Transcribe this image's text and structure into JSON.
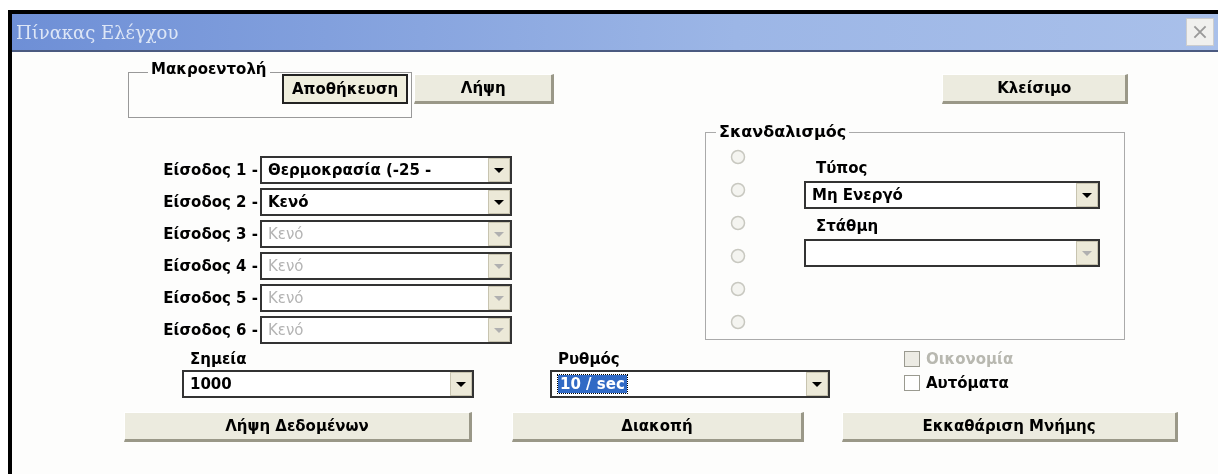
{
  "window": {
    "title": "Πίνακας Ελέγχου"
  },
  "macro": {
    "legend": "Μακροεντολή",
    "buttons": [
      "Αποθήκευση",
      "Λήψη"
    ]
  },
  "close_button": "Κλείσιμο",
  "inputs": [
    {
      "label": "Είσοδος 1 -",
      "value": "Θερμοκρασία (-25 -",
      "disabled": false
    },
    {
      "label": "Είσοδος 2 -",
      "value": "Κενό",
      "disabled": false
    },
    {
      "label": "Είσοδος 3 -",
      "value": "Κενό",
      "disabled": true
    },
    {
      "label": "Είσοδος 4 -",
      "value": "Κενό",
      "disabled": true
    },
    {
      "label": "Είσοδος 5 -",
      "value": "Κενό",
      "disabled": true
    },
    {
      "label": "Είσοδος 6 -",
      "value": "Κενό",
      "disabled": true
    }
  ],
  "scan": {
    "legend": "Σκανδαλισμός",
    "radios": [
      {
        "selected": false,
        "disabled": true
      },
      {
        "selected": false,
        "disabled": true
      },
      {
        "selected": false,
        "disabled": true
      },
      {
        "selected": false,
        "disabled": true
      },
      {
        "selected": false,
        "disabled": true
      },
      {
        "selected": false,
        "disabled": true
      }
    ],
    "type_label": "Τύπος",
    "type": {
      "value": "Μη Ενεργό",
      "disabled": false
    },
    "level_label": "Στάθμη",
    "level": {
      "disabled": true
    }
  },
  "points": {
    "label": "Σημεία",
    "value": "1000",
    "highlighted": false
  },
  "rate": {
    "label": "Ρυθμός",
    "value": "10 / sec",
    "highlighted": true
  },
  "checkboxes": [
    {
      "label": "Οικονομία",
      "checked": false,
      "disabled": true
    },
    {
      "label": "Αυτόματα",
      "checked": false,
      "disabled": false
    }
  ],
  "actions": [
    "Λήψη Δεδομένων",
    "Διακοπή",
    "Εκκαθάριση Μνήμης"
  ]
}
